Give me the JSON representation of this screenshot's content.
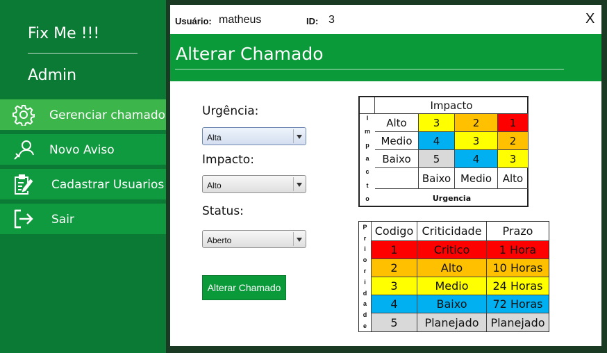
{
  "sidebar": {
    "brand": "Fix Me !!!",
    "role": "Admin",
    "items": [
      {
        "label": "Gerenciar chamados",
        "icon": "gear-icon"
      },
      {
        "label": "Novo Aviso",
        "icon": "user-notice-icon"
      },
      {
        "label": "Cadastrar Usuarios",
        "icon": "clipboard-edit-icon"
      },
      {
        "label": "Sair",
        "icon": "exit-icon"
      }
    ]
  },
  "dialog": {
    "user_label": "Usuário:",
    "user_value": "matheus",
    "id_label": "ID:",
    "id_value": "3",
    "close": "X",
    "title": "Alterar  Chamado"
  },
  "form": {
    "urgencia_label": "Urgência:",
    "urgencia_value": "Alta",
    "impacto_label": "Impacto:",
    "impacto_value": "Alto",
    "status_label": "Status:",
    "status_value": "Aberto",
    "submit_label": "Alterar Chamado"
  },
  "matrix": {
    "header": "Impacto",
    "side_label": [
      "I",
      "m",
      "p",
      "a",
      "c",
      "t",
      "o"
    ],
    "rows": [
      {
        "label": "Alto",
        "cells": [
          "3",
          "2",
          "1"
        ]
      },
      {
        "label": "Medio",
        "cells": [
          "4",
          "3",
          "2"
        ]
      },
      {
        "label": "Baixo",
        "cells": [
          "5",
          "4",
          "3"
        ]
      }
    ],
    "cols": [
      "Baixo",
      "Medio",
      "Alto"
    ],
    "footer": "Urgencia"
  },
  "priority": {
    "side_label": [
      "P",
      "r",
      "i",
      "o",
      "r",
      "i",
      "d",
      "a",
      "d",
      "e"
    ],
    "headers": [
      "Codigo",
      "Criticidade",
      "Prazo"
    ],
    "rows": [
      {
        "codigo": "1",
        "criticidade": "Critico",
        "prazo": "1 Hora"
      },
      {
        "codigo": "2",
        "criticidade": "Alto",
        "prazo": "10 Horas"
      },
      {
        "codigo": "3",
        "criticidade": "Medio",
        "prazo": "24 Horas"
      },
      {
        "codigo": "4",
        "criticidade": "Baixo",
        "prazo": "72 Horas"
      },
      {
        "codigo": "5",
        "criticidade": "Planejado",
        "prazo": "Planejado"
      }
    ]
  },
  "colors": {
    "sidebar": "#0b7a34",
    "accent": "#0b9a3a",
    "critical": "#ff0000",
    "high": "#ffc000",
    "medium": "#ffff00",
    "low": "#00b0f0",
    "planned": "#d9d9d9"
  }
}
